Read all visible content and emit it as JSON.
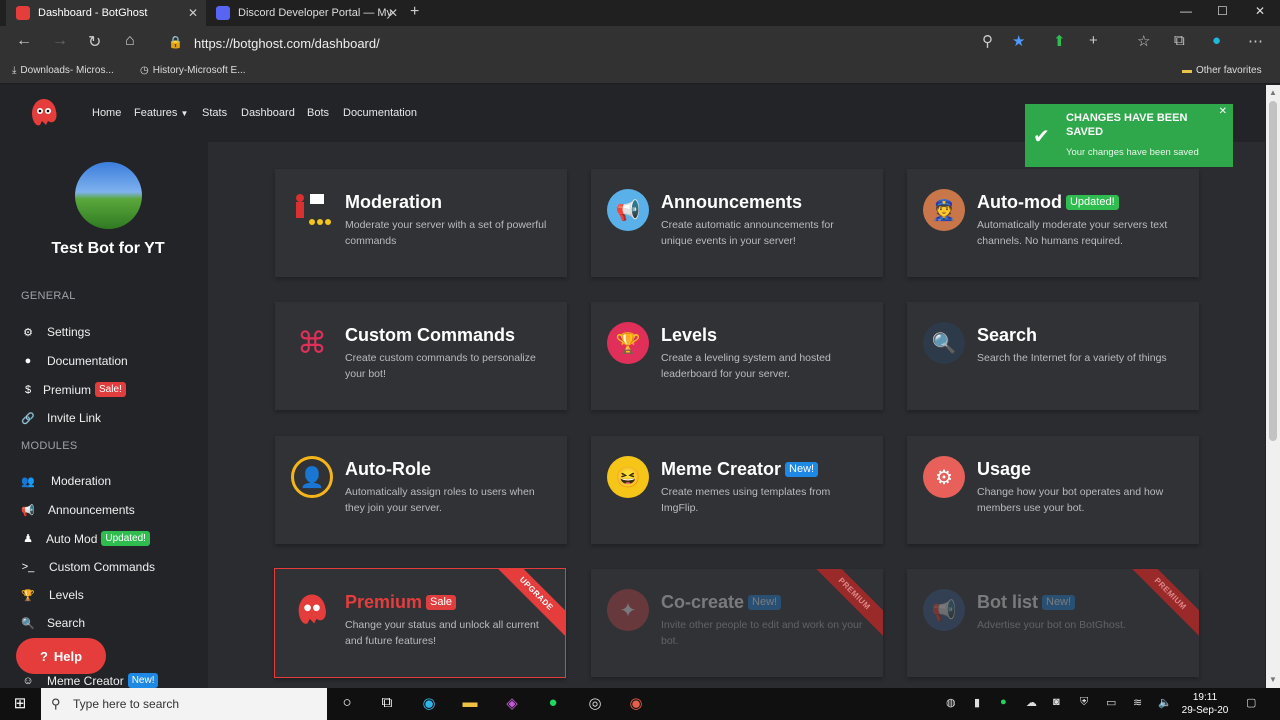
{
  "browser": {
    "tabs": [
      {
        "title": "Dashboard - BotGhost",
        "active": true
      },
      {
        "title": "Discord Developer Portal — My",
        "active": false
      }
    ],
    "url": "https://botghost.com/dashboard/",
    "favorites": [
      "Downloads- Micros...",
      "History-Microsoft E..."
    ],
    "other_favorites": "Other favorites"
  },
  "nav": {
    "links": [
      "Home",
      "Features",
      "Stats",
      "Dashboard",
      "Bots",
      "Documentation"
    ]
  },
  "sidebar": {
    "bot_name": "Test Bot for YT",
    "general_heading": "GENERAL",
    "general_items": [
      {
        "label": "Settings",
        "icon": "gear-icon"
      },
      {
        "label": "Documentation",
        "icon": "book-icon"
      },
      {
        "label": "Premium",
        "icon": "dollar-icon",
        "badge": "Sale!"
      },
      {
        "label": "Invite Link",
        "icon": "link-icon"
      }
    ],
    "modules_heading": "MODULES",
    "module_items": [
      {
        "label": "Moderation",
        "icon": "users-icon"
      },
      {
        "label": "Announcements",
        "icon": "megaphone-icon"
      },
      {
        "label": "Auto Mod",
        "icon": "user-shield-icon",
        "badge": "Updated!"
      },
      {
        "label": "Custom Commands",
        "icon": "terminal-icon"
      },
      {
        "label": "Levels",
        "icon": "trophy-icon"
      },
      {
        "label": "Search",
        "icon": "search-icon"
      },
      {
        "label": "Meme Creator",
        "icon": "smile-icon",
        "badge": "New!"
      }
    ],
    "help": "Help"
  },
  "cards": [
    {
      "title": "Moderation",
      "desc": "Moderate your server with a set of powerful commands"
    },
    {
      "title": "Announcements",
      "desc": "Create automatic announcements for unique events in your server!"
    },
    {
      "title": "Auto-mod",
      "badge": "Updated!",
      "desc": "Automatically moderate your servers text channels. No humans required."
    },
    {
      "title": "Custom Commands",
      "desc": "Create custom commands to personalize your bot!"
    },
    {
      "title": "Levels",
      "desc": "Create a leveling system and hosted leaderboard for your server."
    },
    {
      "title": "Search",
      "desc": "Search the Internet for a variety of things"
    },
    {
      "title": "Auto-Role",
      "desc": "Automatically assign roles to users when they join your server."
    },
    {
      "title": "Meme Creator",
      "badge": "New!",
      "desc": "Create memes using templates from ImgFlip."
    },
    {
      "title": "Usage",
      "desc": "Change how your bot operates and how members use your bot."
    },
    {
      "title": "Premium",
      "badge": "Sale",
      "ribbon": "UPGRADE",
      "desc": "Change your status and unlock all current and future features!"
    },
    {
      "title": "Co-create",
      "badge": "New!",
      "ribbon": "PREMIUM",
      "desc": "Invite other people to edit and work on your bot."
    },
    {
      "title": "Bot list",
      "badge": "New!",
      "ribbon": "PREMIUM",
      "desc": "Advertise your bot on BotGhost."
    }
  ],
  "toast": {
    "title": "CHANGES HAVE BEEN SAVED",
    "message": "Your changes have been saved"
  },
  "taskbar": {
    "search_placeholder": "Type here to search",
    "time": "19:11",
    "date": "29-Sep-20"
  }
}
